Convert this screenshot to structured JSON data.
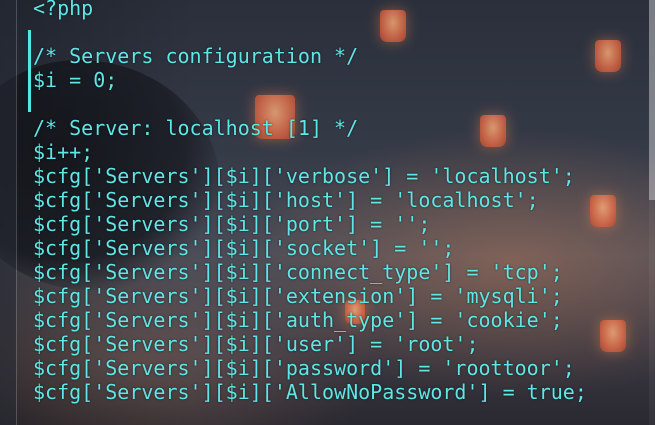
{
  "editor": {
    "text_color": "#5fe6e6",
    "accent_color": "#50e8e0",
    "lines": [
      "<?php",
      "",
      "/* Servers configuration */",
      "$i = 0;",
      "",
      "/* Server: localhost [1] */",
      "$i++;",
      "$cfg['Servers'][$i]['verbose'] = 'localhost';",
      "$cfg['Servers'][$i]['host'] = 'localhost';",
      "$cfg['Servers'][$i]['port'] = '';",
      "$cfg['Servers'][$i]['socket'] = '';",
      "$cfg['Servers'][$i]['connect_type'] = 'tcp';",
      "$cfg['Servers'][$i]['extension'] = 'mysqli';",
      "$cfg['Servers'][$i]['auth_type'] = 'cookie';",
      "$cfg['Servers'][$i]['user'] = 'root';",
      "$cfg['Servers'][$i]['password'] = 'roottoor';",
      "$cfg['Servers'][$i]['AllowNoPassword'] = true;",
      ""
    ]
  }
}
